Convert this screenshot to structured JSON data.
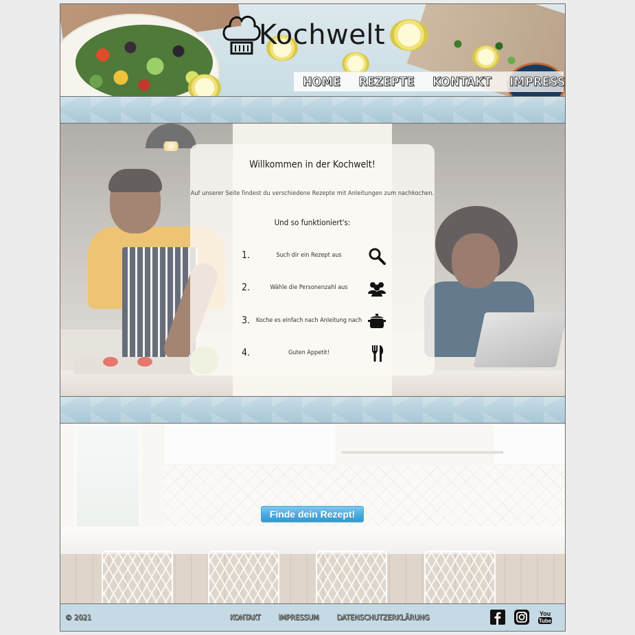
{
  "brand": {
    "name": "Kochwelt"
  },
  "nav": {
    "items": [
      {
        "label": "HOME"
      },
      {
        "label": "REZEPTE"
      },
      {
        "label": "KONTAKT"
      },
      {
        "label": "IMPRESSUM"
      }
    ]
  },
  "welcome": {
    "title": "Willkommen in der Kochwelt!",
    "intro": "Auf unserer Seite findest du verschiedene Rezepte mit Anleitungen zum nachkochen.",
    "how_heading": "Und so funktioniert's:",
    "steps": [
      {
        "number": "1.",
        "text": "Such dir ein Rezept aus",
        "icon": "magnifier-icon"
      },
      {
        "number": "2.",
        "text": "Wähle die Personenzahl aus",
        "icon": "people-icon"
      },
      {
        "number": "3.",
        "text": "Koche es einfach nach Anleitung nach",
        "icon": "pot-icon"
      },
      {
        "number": "4.",
        "text": "Guten Appetit!",
        "icon": "cutlery-icon"
      }
    ]
  },
  "cta": {
    "button_label": "Finde dein Rezept!"
  },
  "footer": {
    "copyright": "© 2021",
    "links": [
      {
        "label": "KONTAKT"
      },
      {
        "label": "IMPRESSUM"
      },
      {
        "label": "DATENSCHUTZERKLÄRUNG"
      }
    ],
    "social": [
      {
        "icon": "facebook-icon"
      },
      {
        "icon": "instagram-icon"
      },
      {
        "icon": "youtube-icon",
        "text": "You Tube"
      }
    ]
  },
  "colors": {
    "band": "#b4d0dc",
    "footer": "#c5dae4",
    "button": "#4ba9dd",
    "card": "#fcf9f4"
  }
}
